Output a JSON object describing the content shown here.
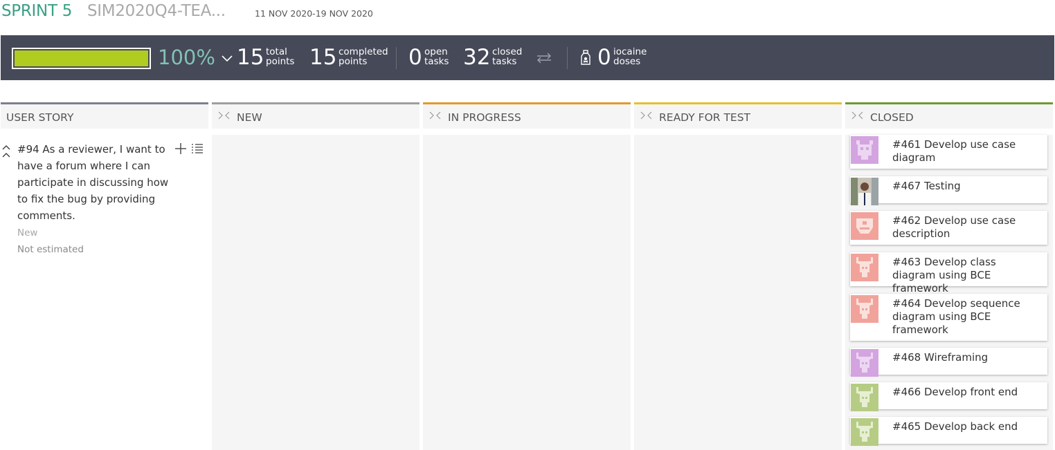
{
  "sprint": {
    "name": "SPRINT 5",
    "project": "SIM2020Q4-TEA...",
    "dates": "11 NOV 2020-19 NOV 2020"
  },
  "summary": {
    "progress_fraction": 1.0,
    "percent": "100%",
    "total_points_value": "15",
    "total_points_label": [
      "total",
      "points"
    ],
    "completed_points_value": "15",
    "completed_points_label": [
      "completed",
      "points"
    ],
    "open_tasks_value": "0",
    "open_tasks_label": [
      "open",
      "tasks"
    ],
    "closed_tasks_value": "32",
    "closed_tasks_label": [
      "closed",
      "tasks"
    ],
    "iocaine_value": "0",
    "iocaine_label": [
      "iocaine",
      "doses"
    ],
    "colors": {
      "bar_bg": "#464957",
      "progress": "#b0cc20",
      "percent": "#83c1b7"
    }
  },
  "columns": {
    "user_story": {
      "title": "USER STORY",
      "color": "#7e7e8f"
    },
    "new": {
      "title": "NEW",
      "color": "#9e9e9e"
    },
    "in_progress": {
      "title": "IN PROGRESS",
      "color": "#e39a2b"
    },
    "ready_for_test": {
      "title": "READY FOR TEST",
      "color": "#e5c12e"
    },
    "closed": {
      "title": "CLOSED",
      "color": "#6c9a2f"
    }
  },
  "story": {
    "text": "#94 As a reviewer, I want to have a forum where I can participate in discussing how to fix the bug by providing comments.",
    "status": "New",
    "estimate": "Not estimated",
    "icons": [
      "fold-icon",
      "add-icon",
      "list-icon"
    ]
  },
  "closed_tasks": [
    {
      "title": "#461 Develop use case diagram",
      "avatar": "identicon-purple-cat"
    },
    {
      "title": "#467 Testing",
      "avatar": "user-photo"
    },
    {
      "title": "#462 Develop use case description",
      "avatar": "identicon-pink-face"
    },
    {
      "title": "#463 Develop class diagram using BCE framework",
      "avatar": "identicon-pink-deer"
    },
    {
      "title": "#464 Develop sequence diagram using BCE framework",
      "avatar": "identicon-pink-deer"
    },
    {
      "title": "#468 Wireframing",
      "avatar": "identicon-purple-deer"
    },
    {
      "title": "#466 Develop front end",
      "avatar": "identicon-green-deer"
    },
    {
      "title": "#465 Develop back end",
      "avatar": "identicon-green-deer"
    }
  ]
}
